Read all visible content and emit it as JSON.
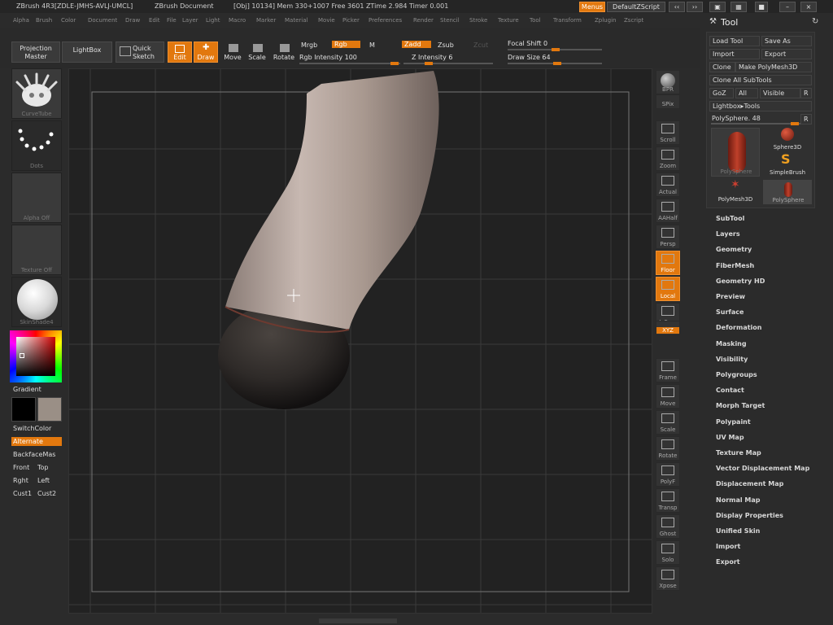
{
  "titlebar": {
    "app": "ZBrush 4R3[ZDLE-JMHS-AVLJ-UMCL]",
    "document": "ZBrush Document",
    "stats": "[Obj] 10134] Mem 330+1007 Free 3601 ZTime 2.984 Timer 0.001",
    "menus_btn": "Menus",
    "script_btn": "DefaultZScript"
  },
  "menubar": [
    "Alpha",
    "Brush",
    "Color",
    "Document",
    "Draw",
    "Edit",
    "File",
    "Layer",
    "Light",
    "Macro",
    "Marker",
    "Material",
    "Movie",
    "Picker",
    "Preferences",
    "Render",
    "Stencil",
    "Stroke",
    "Texture",
    "Tool",
    "Transform",
    "Zplugin",
    "Zscript"
  ],
  "toolbar": {
    "projection_master": "Projection Master",
    "lightbox": "LightBox",
    "quick_sketch": "Quick Sketch",
    "edit": "Edit",
    "draw": "Draw",
    "move": "Move",
    "scale": "Scale",
    "rotate": "Rotate",
    "mrgb": "Mrgb",
    "rgb": "Rgb",
    "m": "M",
    "zadd": "Zadd",
    "zsub": "Zsub",
    "zcut": "Zcut",
    "rgb_intensity_label": "Rgb Intensity 100",
    "rgb_intensity": 100,
    "z_intensity_label": "Z Intensity 6",
    "z_intensity": 6,
    "focal_shift_label": "Focal Shift 0",
    "draw_size_label": "Draw Size 64"
  },
  "leftshelf": {
    "brush": "CurveTube",
    "stroke": "Dots",
    "alpha": "Alpha Off",
    "texture": "Texture Off",
    "material": "SkinShade4",
    "gradient": "Gradient",
    "switch_color": "SwitchColor",
    "alternate": "Alternate",
    "backface": "BackfaceMas",
    "front": "Front",
    "top": "Top",
    "right": "Rght",
    "left": "Left",
    "cust1": "Cust1",
    "cust2": "Cust2"
  },
  "rightshelf": [
    "BPR",
    "SPix",
    "Scroll",
    "Zoom",
    "Actual",
    "AAHalf",
    "Persp",
    "Floor",
    "Local",
    "L.Sym",
    "XYZ",
    "Frame",
    "Move",
    "Scale",
    "Rotate",
    "PolyF",
    "Transp",
    "Ghost",
    "Solo",
    "Xpose"
  ],
  "toolpanel": {
    "title": "Tool",
    "load_tool": "Load Tool",
    "save_as": "Save As",
    "import": "Import",
    "export": "Export",
    "clone": "Clone",
    "make_polymesh": "Make PolyMesh3D",
    "clone_all": "Clone All SubTools",
    "goz": "GoZ",
    "all": "All",
    "visible": "Visible",
    "r": "R",
    "lightbox_tools": "Lightbox▸Tools",
    "polysphere_label": "PolySphere. 48",
    "thumbs": [
      "PolySphere",
      "Sphere3D",
      "SimpleBrush",
      "PolyMesh3D",
      "PolySphere"
    ],
    "sections": [
      "SubTool",
      "Layers",
      "Geometry",
      "FiberMesh",
      "Geometry HD",
      "Preview",
      "Surface",
      "Deformation",
      "Masking",
      "Visibility",
      "Polygroups",
      "Contact",
      "Morph Target",
      "Polypaint",
      "UV Map",
      "Texture Map",
      "Vector Displacement Map",
      "Displacement Map",
      "Normal Map",
      "Display Properties",
      "Unified Skin",
      "Import",
      "Export"
    ]
  },
  "colors": {
    "accent": "#e2780e",
    "panel": "#2b2b2b",
    "canvas": "#222222"
  }
}
